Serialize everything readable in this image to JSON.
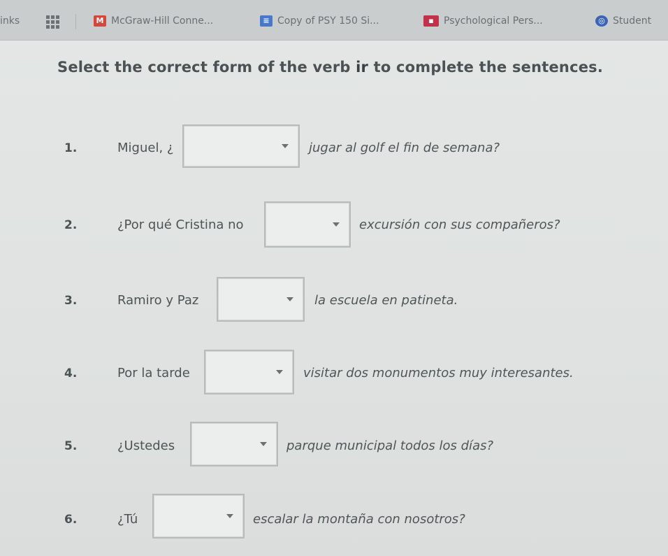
{
  "bookmarks": {
    "items": [
      {
        "label": "inks"
      },
      {
        "label": "McGraw-Hill Conne..."
      },
      {
        "label": "Copy of PSY 150 Si..."
      },
      {
        "label": "Psychological Pers..."
      },
      {
        "label": "Student"
      }
    ]
  },
  "exercise": {
    "instructions_pre": "Select the correct form of the verb ",
    "instructions_verb": "ir",
    "instructions_post": " to complete the sentences.",
    "questions": [
      {
        "number": "1.",
        "prefix": "Miguel, ¿",
        "suffix": "jugar al golf el fin de semana?"
      },
      {
        "number": "2.",
        "prefix": "¿Por qué Cristina no",
        "suffix": "excursión con sus compañeros?"
      },
      {
        "number": "3.",
        "prefix": "Ramiro y Paz",
        "suffix": "la escuela en patineta."
      },
      {
        "number": "4.",
        "prefix": "Por la tarde",
        "suffix": "visitar dos monumentos muy interesantes."
      },
      {
        "number": "5.",
        "prefix": "¿Ustedes",
        "suffix": "parque municipal todos los días?"
      },
      {
        "number": "6.",
        "prefix": "¿Tú",
        "suffix": "escalar la montaña con nosotros?"
      }
    ]
  },
  "colors": {
    "mcgraw_icon": "#d4473c",
    "docs_icon": "#4a78c8",
    "psych_icon": "#c2324a",
    "student_icon": "#3a64b8"
  }
}
